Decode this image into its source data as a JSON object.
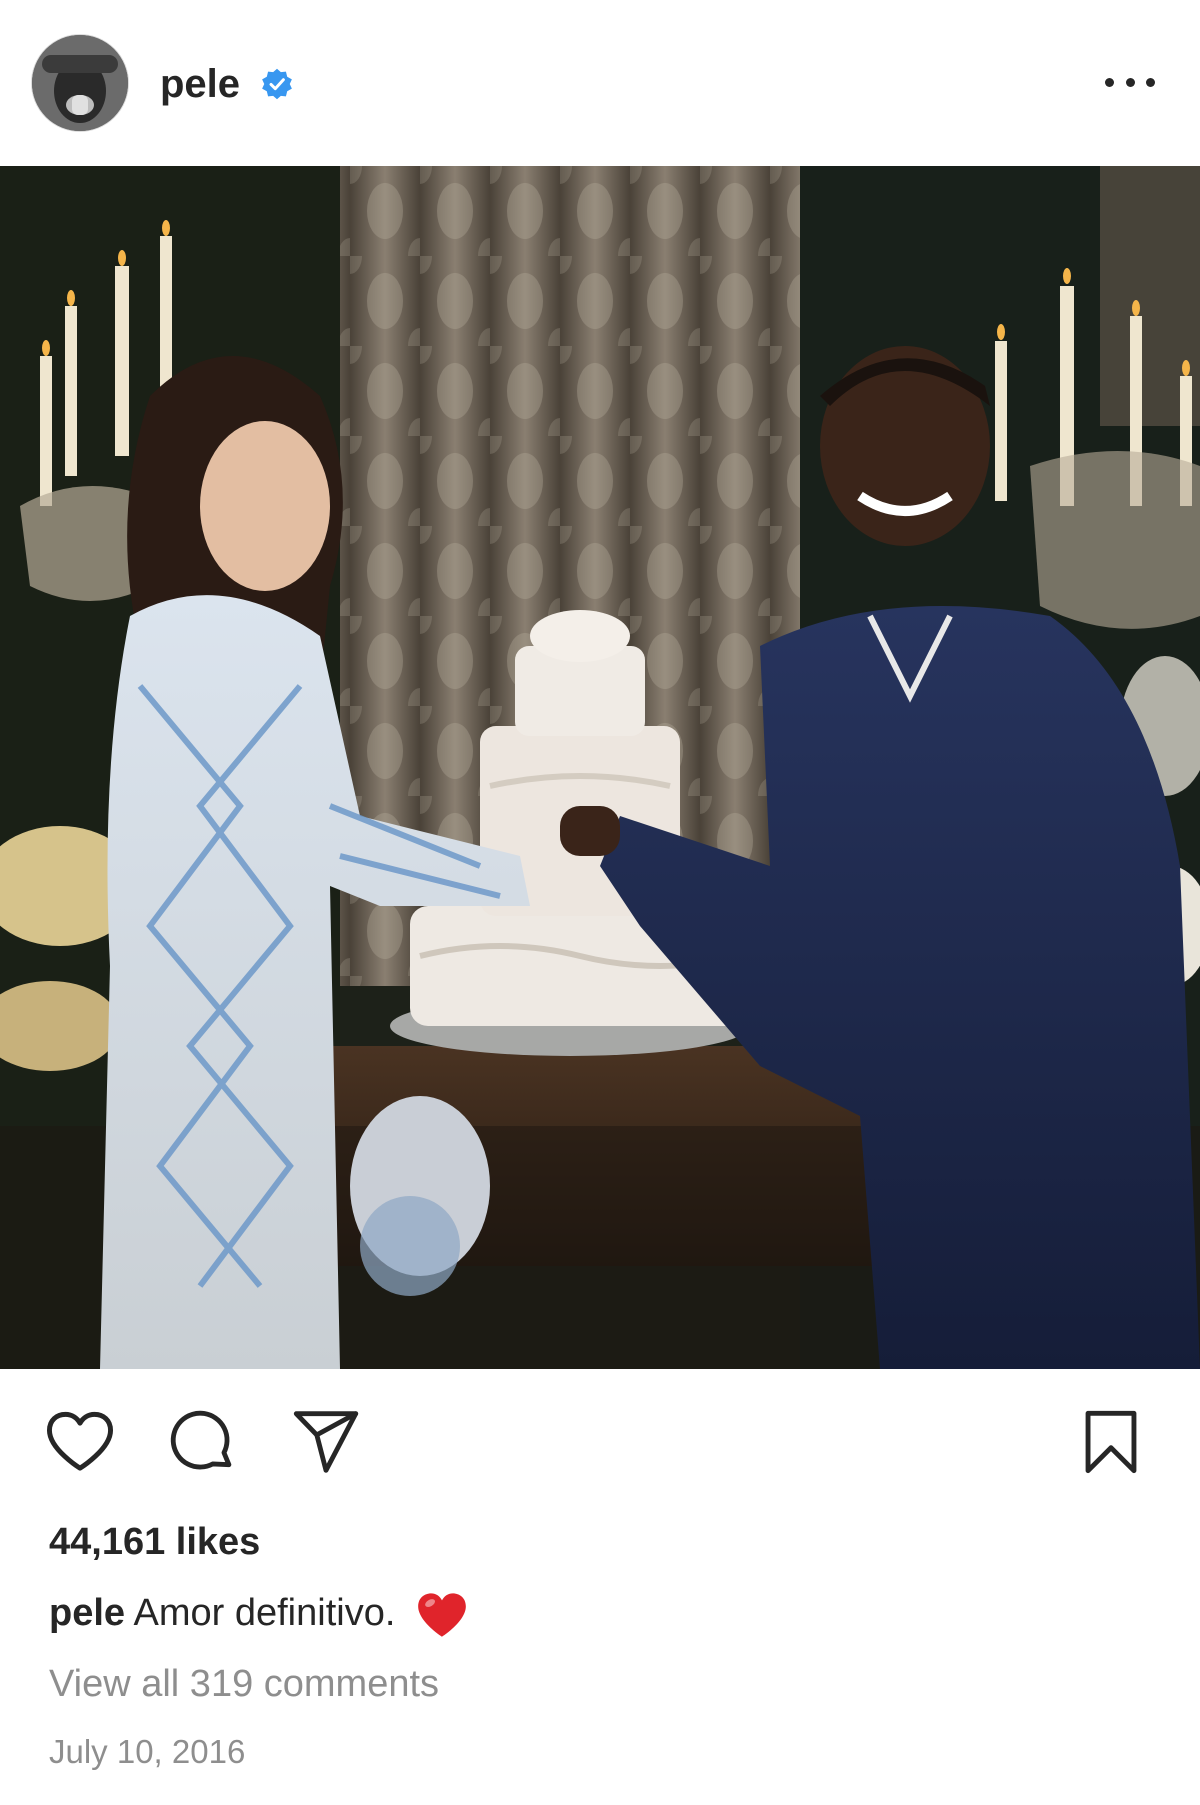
{
  "post": {
    "username": "pele",
    "verified": true,
    "more_icon": "more-horizontal-icon",
    "photo_alt": "pele post photo",
    "likes_text": "44,161 likes",
    "caption_user": "pele",
    "caption_text": "Amor definitivo.",
    "caption_emoji": "red-heart",
    "comments_link": "View all 319 comments",
    "date": "July 10, 2016"
  },
  "actions": {
    "like_icon": "heart-outline-icon",
    "comment_icon": "comment-bubble-icon",
    "share_icon": "paper-plane-icon",
    "save_icon": "bookmark-outline-icon"
  },
  "colors": {
    "text": "#262626",
    "muted": "#8e8e8e",
    "verified_blue": "#3897f0",
    "heart_red": "#e0242b"
  }
}
